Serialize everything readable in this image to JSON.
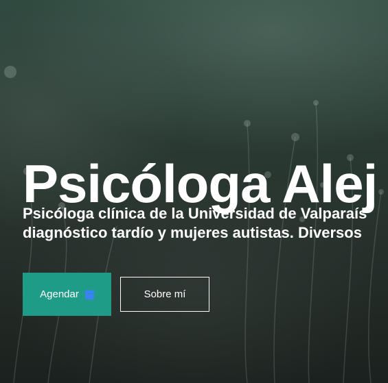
{
  "hero": {
    "title": "Psicóloga Alej",
    "subtitle_line1": "Psicóloga clínica de la Universidad de Valparaís",
    "subtitle_line2": "diagnóstico tardío y mujeres autistas. Diversos",
    "primary_button": {
      "label": "Agendar",
      "icon": "calendar-icon"
    },
    "secondary_button": {
      "label": "Sobre mí"
    }
  },
  "colors": {
    "accent": "#1f9c88",
    "text": "#ffffff",
    "background": "#24302a"
  }
}
